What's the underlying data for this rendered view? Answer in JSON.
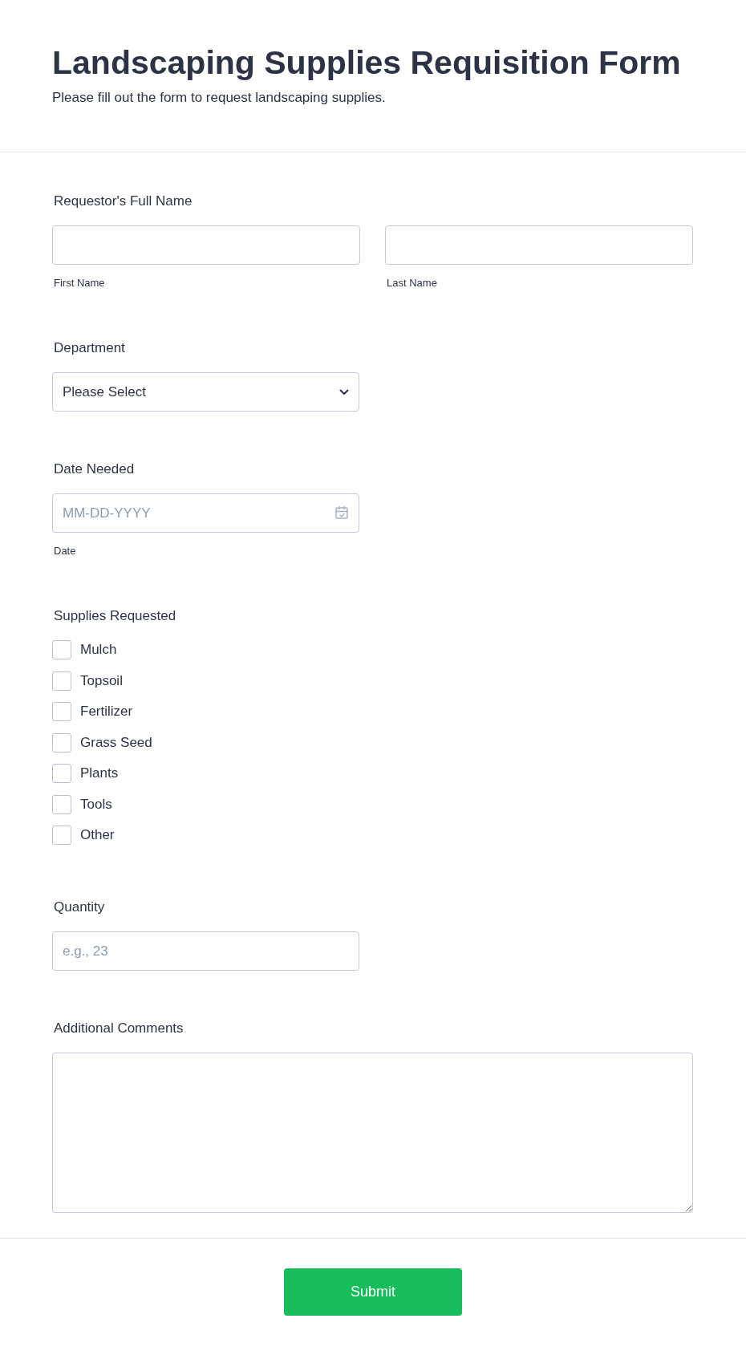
{
  "header": {
    "title": "Landscaping Supplies Requisition Form",
    "subtitle": "Please fill out the form to request landscaping supplies."
  },
  "fields": [
    {
      "kind": "name",
      "label": "Requestor's Full Name",
      "parts": [
        {
          "sublabel": "First Name"
        },
        {
          "sublabel": "Last Name"
        }
      ]
    },
    {
      "kind": "select",
      "label": "Department",
      "value": "Please Select"
    },
    {
      "kind": "date",
      "label": "Date Needed",
      "placeholder": "MM-DD-YYYY",
      "sublabel": "Date"
    },
    {
      "kind": "checkboxes",
      "label": "Supplies Requested",
      "options": [
        {
          "label": "Mulch",
          "checked": false
        },
        {
          "label": "Topsoil",
          "checked": false
        },
        {
          "label": "Fertilizer",
          "checked": false
        },
        {
          "label": "Grass Seed",
          "checked": false
        },
        {
          "label": "Plants",
          "checked": false
        },
        {
          "label": "Tools",
          "checked": false
        },
        {
          "label": "Other",
          "checked": false
        }
      ]
    },
    {
      "kind": "number",
      "label": "Quantity",
      "placeholder": "e.g., 23"
    },
    {
      "kind": "textarea",
      "label": "Additional Comments"
    }
  ],
  "submit": {
    "label": "Submit"
  }
}
